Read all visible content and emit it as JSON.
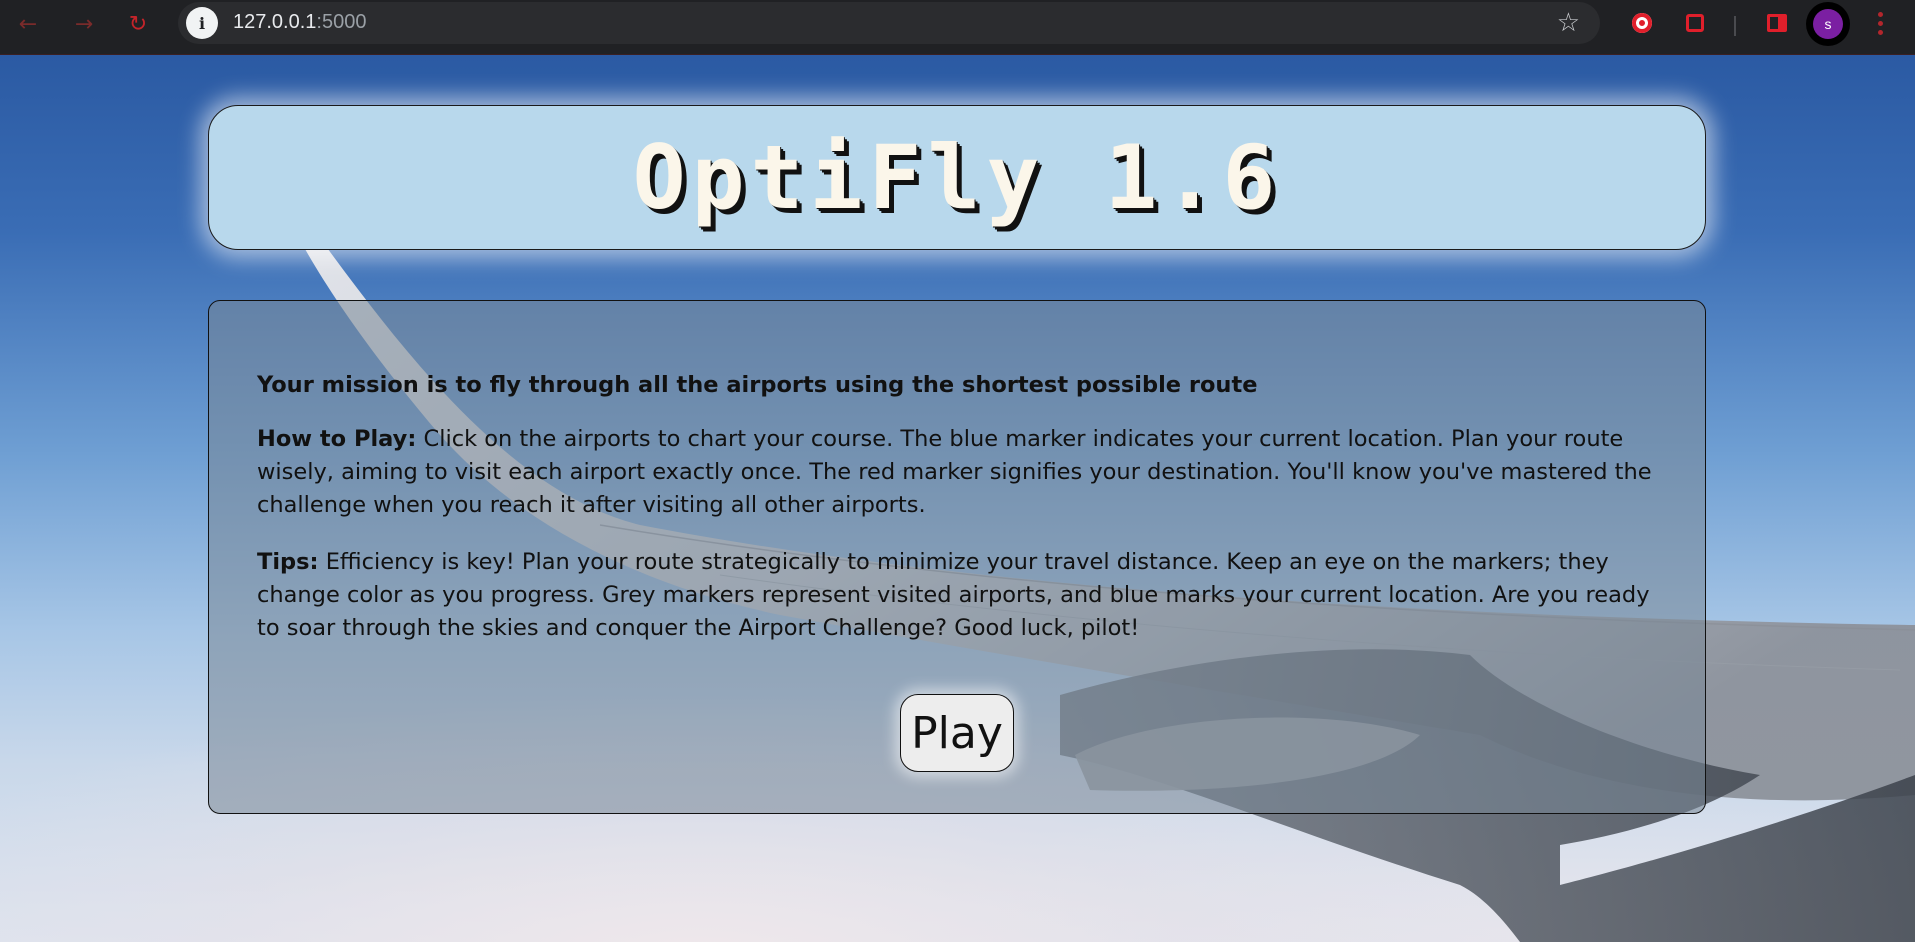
{
  "browser": {
    "url_host": "127.0.0.1",
    "url_port": ":5000",
    "avatar_initial": "s"
  },
  "page": {
    "title": "OptiFly 1.6",
    "mission": "Your mission is to fly through all the airports using the shortest possible route",
    "how_to_play_label": "How to Play:",
    "how_to_play_text": " Click on the airports to chart your course. The blue marker indicates your current location. Plan your route wisely, aiming to visit each airport exactly once. The red marker signifies your destination. You'll know you've mastered the challenge when you reach it after visiting all other airports.",
    "tips_label": "Tips:",
    "tips_text": " Efficiency is key! Plan your route strategically to minimize your travel distance. Keep an eye on the markers; they change color as you progress. Grey markers represent visited airports, and blue marks your current location. Are you ready to soar through the skies and conquer the Airport Challenge? Good luck, pilot!",
    "play_label": "Play"
  },
  "icons": {
    "back": "arrow-left-icon",
    "forward": "arrow-right-icon",
    "reload": "reload-icon",
    "site_info": "info-icon",
    "bookmark": "star-icon",
    "extensions": [
      "extension-red-icon",
      "puzzle-icon",
      "side-panel-icon"
    ],
    "menu": "kebab-menu-icon"
  },
  "colors": {
    "title_card_bg": "#b8d8ec",
    "title_text": "#fbf6ea",
    "accent_red": "#e01f2b",
    "avatar": "#7b1fa2"
  }
}
